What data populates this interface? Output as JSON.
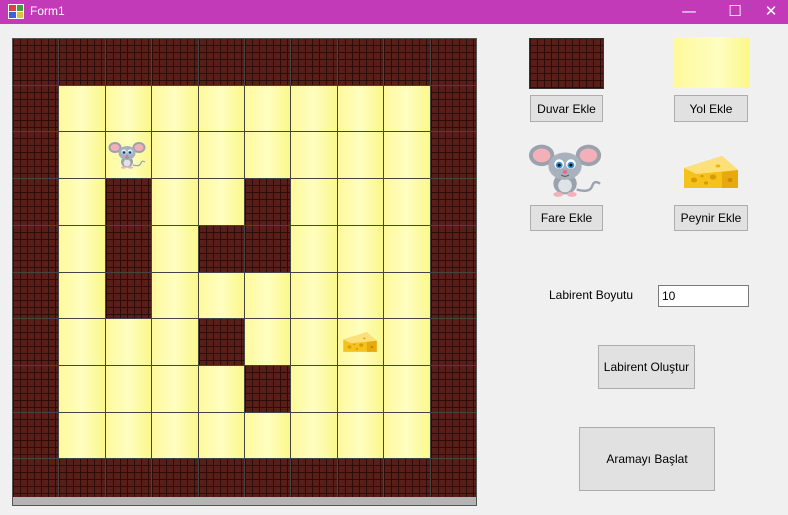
{
  "window": {
    "title": "Form1",
    "controls": {
      "minimize": "—",
      "maximize": "☐",
      "close": "✕"
    }
  },
  "colors": {
    "titlebar": "#c23ab8",
    "wall": "#5a1e18",
    "path": "#fffab0"
  },
  "maze": {
    "size": 10,
    "grid": [
      [
        "W",
        "W",
        "W",
        "W",
        "W",
        "W",
        "W",
        "W",
        "W",
        "W"
      ],
      [
        "W",
        "P",
        "P",
        "P",
        "P",
        "P",
        "P",
        "P",
        "P",
        "W"
      ],
      [
        "W",
        "P",
        "M",
        "P",
        "P",
        "P",
        "P",
        "P",
        "P",
        "W"
      ],
      [
        "W",
        "P",
        "W",
        "P",
        "P",
        "W",
        "P",
        "P",
        "P",
        "W"
      ],
      [
        "W",
        "P",
        "W",
        "P",
        "W",
        "W",
        "P",
        "P",
        "P",
        "W"
      ],
      [
        "W",
        "P",
        "W",
        "P",
        "P",
        "P",
        "P",
        "P",
        "P",
        "W"
      ],
      [
        "W",
        "P",
        "P",
        "P",
        "W",
        "P",
        "P",
        "C",
        "P",
        "W"
      ],
      [
        "W",
        "P",
        "P",
        "P",
        "P",
        "W",
        "P",
        "P",
        "P",
        "W"
      ],
      [
        "W",
        "P",
        "P",
        "P",
        "P",
        "P",
        "P",
        "P",
        "P",
        "W"
      ],
      [
        "W",
        "W",
        "W",
        "W",
        "W",
        "W",
        "W",
        "W",
        "W",
        "W"
      ]
    ]
  },
  "palette": {
    "wall_icon": "brick-wall-icon",
    "path_icon": "path-tile-icon",
    "mouse_icon": "mouse-icon",
    "cheese_icon": "cheese-icon"
  },
  "buttons": {
    "add_wall": "Duvar Ekle",
    "add_path": "Yol Ekle",
    "add_mouse": "Fare Ekle",
    "add_cheese": "Peynir Ekle",
    "create_maze": "Labirent Oluştur",
    "start_search": "Aramayı Başlat"
  },
  "maze_size": {
    "label": "Labirent Boyutu",
    "value": "10"
  }
}
